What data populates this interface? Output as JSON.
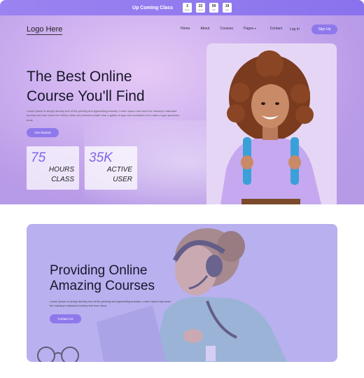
{
  "announcement": {
    "title": "Up Coming Class",
    "countdown": [
      {
        "value": "3",
        "unit": "Days"
      },
      {
        "value": "22",
        "unit": "Hours"
      },
      {
        "value": "59",
        "unit": "Min"
      },
      {
        "value": "19",
        "unit": "Sec"
      }
    ]
  },
  "header": {
    "logo": "Logo Here",
    "nav": [
      "Home",
      "About",
      "Courses",
      "Pages",
      "Contact"
    ],
    "login": "Log In",
    "signup": "Sign Up"
  },
  "hero": {
    "title_line1": "The Best Online",
    "title_line2": "Course You'll Find",
    "description": "Lorem Ipsum is simply dummy text of the printing and typesetting industry. Lorem Ipsum has been the industry's standard dummy text ever since the 1500s, when an unknown printer took a galley of type and scrambled it to make a type specimen book.",
    "button": "Get Started",
    "stats": [
      {
        "number": "75",
        "line1": "HOURS",
        "line2": "CLASS"
      },
      {
        "number": "35K",
        "line1": "ACTIVE",
        "line2": "USER"
      }
    ]
  },
  "course_section": {
    "title_line1": "Providing Online",
    "title_line2": "Amazing Courses",
    "description": "Lorem Ipsum is simply dummy text of the printing and typesetting industry. Lorem Ipsum has been the industry's standard dummy text ever since.",
    "button": "Contact Us"
  },
  "colors": {
    "accent": "#8f78ec",
    "stat_number": "#8066e6",
    "hero_bg": "#c9aef0",
    "course_bg": "#bcb4ef"
  }
}
